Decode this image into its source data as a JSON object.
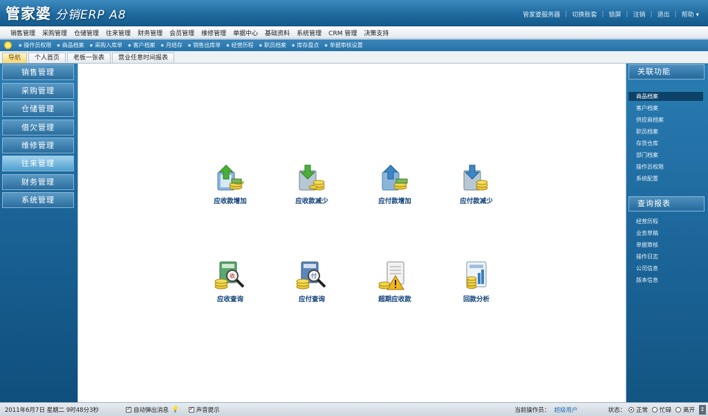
{
  "app": {
    "logo": "管家婆",
    "logo_sub": "分销ERP A8"
  },
  "top_nav": [
    "管家婆服务器",
    "切换账套",
    "锁屏",
    "注销",
    "退出",
    "帮助"
  ],
  "menu": [
    "销售管理",
    "采购管理",
    "仓储管理",
    "往来管理",
    "财务管理",
    "会员管理",
    "维修管理",
    "单据中心",
    "基础资料",
    "系统管理",
    "CRM 管理",
    "决策支持"
  ],
  "quick": [
    "操作员权限",
    "商品档案",
    "采购入库单",
    "客户档案",
    "月结存",
    "销售出库单",
    "经营历程",
    "职员档案",
    "库存盘点",
    "单据审核设置"
  ],
  "tabs": [
    "导航",
    "个人首页",
    "老板一张表",
    "营业任意时间报表"
  ],
  "left_nav": [
    "销售管理",
    "采购管理",
    "仓储管理",
    "借欠管理",
    "维修管理",
    "往来管理",
    "财务管理",
    "系统管理"
  ],
  "tiles": [
    "应收款增加",
    "应收款减少",
    "应付款增加",
    "应付款减少",
    "应收查询",
    "应付查询",
    "超期应收款",
    "回款分析"
  ],
  "right": {
    "related_title": "关联功能",
    "related": [
      "商品档案",
      "客户档案",
      "供应商档案",
      "职员档案",
      "存货仓库",
      "部门档案",
      "操作员权限",
      "系统配置"
    ],
    "reports_title": "查询报表",
    "reports": [
      "经营历程",
      "业务草稿",
      "单据审核",
      "操作日志",
      "公司信息",
      "版本信息"
    ]
  },
  "status": {
    "datetime": "2011年6月7日 星期二 9时48分3秒",
    "auto_popup": "自动弹出消息",
    "sound": "声音提示",
    "operator_label": "当前操作员：",
    "operator": "超级用户",
    "state_label": "状态：",
    "states": [
      "正常",
      "忙碌",
      "离开"
    ]
  },
  "colors": {
    "accent": "#1f6a9e",
    "tile_text": "#0c3f78",
    "active_tab": "#f3d776"
  }
}
